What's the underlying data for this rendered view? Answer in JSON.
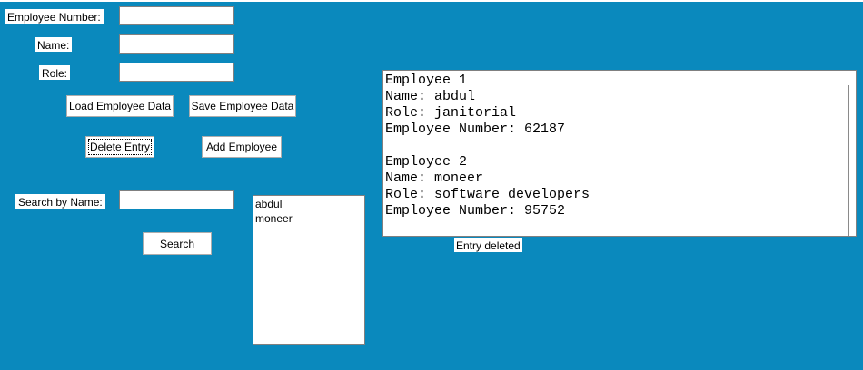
{
  "form": {
    "employee_number_label": "Employee Number:",
    "employee_number_value": "",
    "name_label": "Name:",
    "name_value": "",
    "role_label": "Role:",
    "role_value": "",
    "search_label": "Search by Name:",
    "search_value": ""
  },
  "buttons": {
    "load": "Load Employee Data",
    "save": "Save Employee Data",
    "delete": "Delete Entry",
    "add": "Add Employee",
    "search": "Search"
  },
  "name_list": {
    "items": [
      "abdul",
      "moneer"
    ]
  },
  "output": {
    "text": "Employee 1\nName: abdul\nRole: janitorial\nEmployee Number: 62187\n\nEmployee 2\nName: moneer\nRole: software developers\nEmployee Number: 95752"
  },
  "status": {
    "message": "Entry deleted"
  },
  "colors": {
    "background": "#0a89bd",
    "widget": "#ffffff"
  }
}
